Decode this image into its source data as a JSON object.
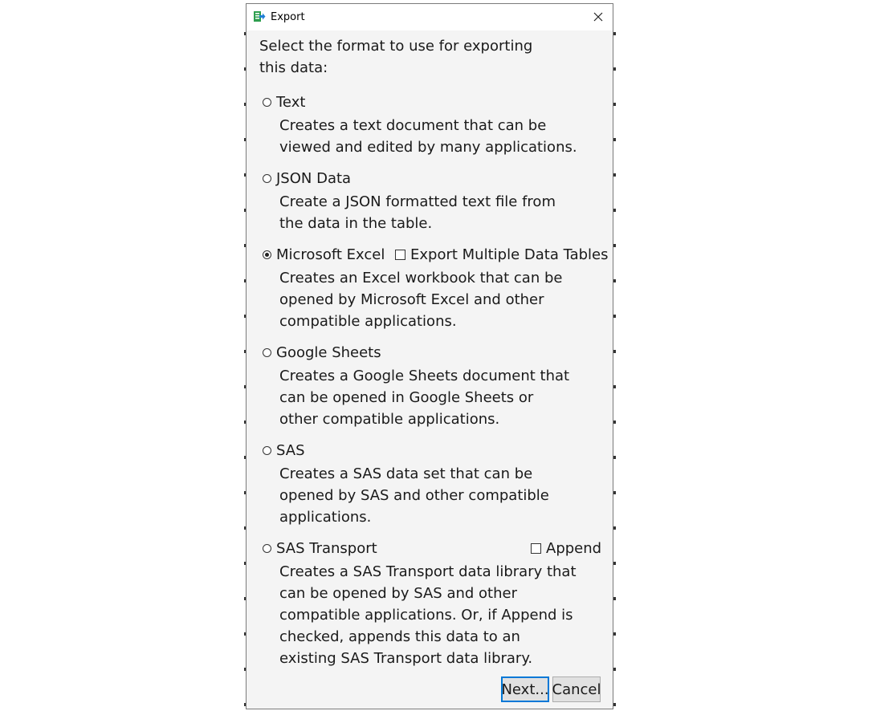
{
  "window": {
    "title": "Export",
    "close_glyph": "✕",
    "app_icon": "export-arrow-icon"
  },
  "intro": {
    "lines": [
      "Select the format to use for exporting",
      "this data:"
    ]
  },
  "options": [
    {
      "label": "Text",
      "selected": false,
      "description": [
        "Creates a text document that can be",
        "viewed and edited by many applications."
      ]
    },
    {
      "label": "JSON Data",
      "selected": false,
      "description": [
        "Create a JSON formatted text file from",
        "the data in the table."
      ]
    },
    {
      "label": "Microsoft Excel",
      "selected": true,
      "checkbox_label": "Export Multiple Data Tables",
      "checkbox_checked": false,
      "description": [
        "Creates an Excel workbook that can be",
        "opened by Microsoft Excel and other",
        "compatible applications."
      ]
    },
    {
      "label": "Google Sheets",
      "selected": false,
      "description": [
        "Creates a Google Sheets document that",
        "can be opened in Google Sheets or",
        "other compatible applications."
      ]
    },
    {
      "label": "SAS",
      "selected": false,
      "description": [
        "Creates a SAS data set that can be",
        "opened by SAS and other compatible",
        "applications."
      ]
    },
    {
      "label": "SAS Transport",
      "selected": false,
      "checkbox_label": "Append",
      "checkbox_checked": false,
      "description": [
        "Creates a SAS Transport data library that",
        "can be opened by SAS and other",
        "compatible applications. Or, if Append is",
        "checked, appends this data to an",
        "existing SAS Transport data library."
      ]
    }
  ],
  "buttons": {
    "next": "Next...",
    "cancel": "Cancel"
  },
  "colors": {
    "dialog_bg": "#f4f4f4",
    "titlebar_bg": "#ffffff",
    "accent": "#0078d7",
    "icon_green": "#2e9e4f"
  }
}
